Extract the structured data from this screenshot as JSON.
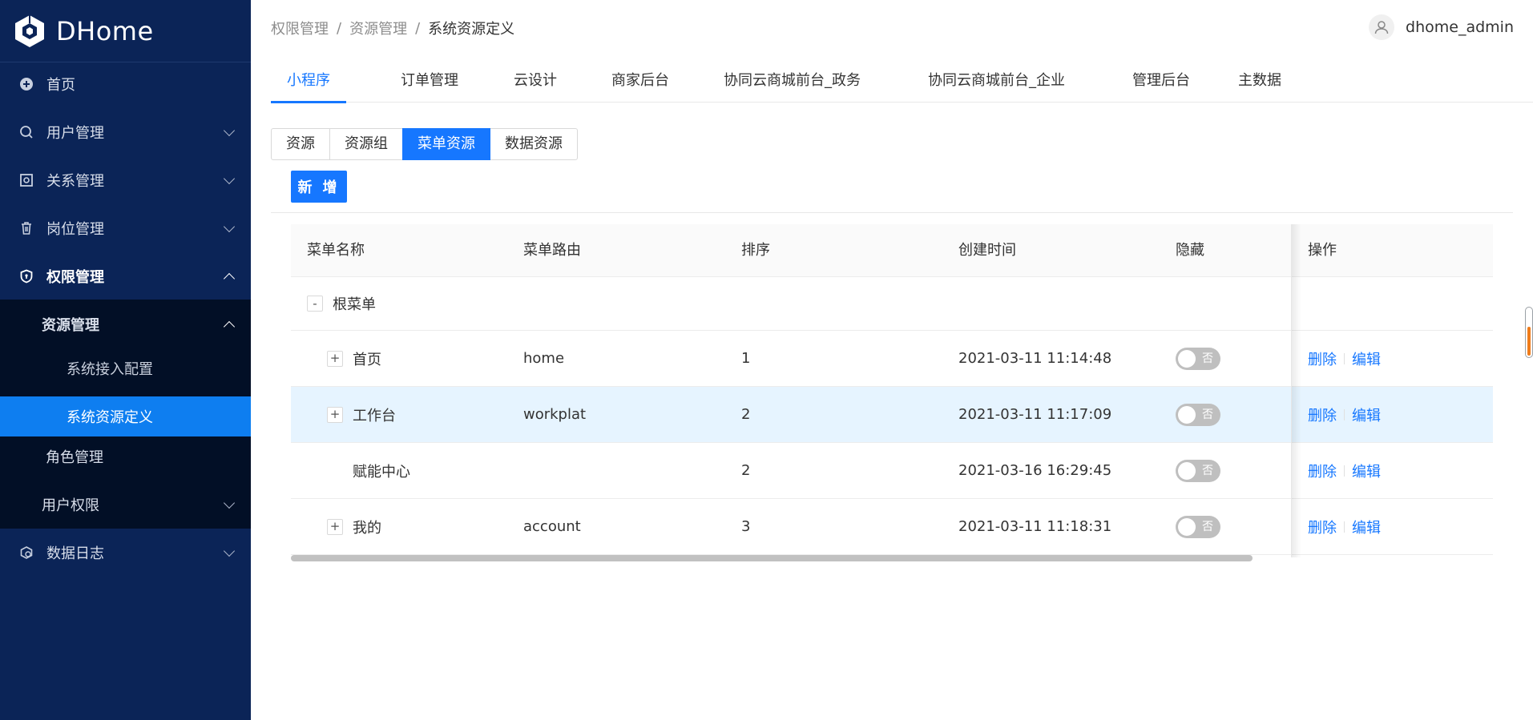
{
  "brand": {
    "name": "DHome"
  },
  "sidebar": {
    "items": [
      {
        "label": "首页",
        "icon": "plus-circle-icon"
      },
      {
        "label": "用户管理",
        "icon": "search-icon"
      },
      {
        "label": "关系管理",
        "icon": "relation-icon"
      },
      {
        "label": "岗位管理",
        "icon": "trash-icon"
      },
      {
        "label": "权限管理",
        "icon": "shield-icon"
      },
      {
        "label": "资源管理"
      },
      {
        "label": "系统接入配置"
      },
      {
        "label": "系统资源定义"
      },
      {
        "label": "角色管理"
      },
      {
        "label": "用户权限"
      },
      {
        "label": "数据日志",
        "icon": "log-icon"
      }
    ]
  },
  "breadcrumb": {
    "items": [
      "权限管理",
      "资源管理",
      "系统资源定义"
    ]
  },
  "user": {
    "name": "dhome_admin"
  },
  "top_tabs": [
    "小程序",
    "订单管理",
    "云设计",
    "商家后台",
    "协同云商城前台_政务",
    "协同云商城前台_企业",
    "管理后台",
    "主数据"
  ],
  "segments": [
    "资源",
    "资源组",
    "菜单资源",
    "数据资源"
  ],
  "add_button": "新 增",
  "table": {
    "columns": [
      "菜单名称",
      "菜单路由",
      "排序",
      "创建时间",
      "隐藏",
      "操作"
    ],
    "root": {
      "expander": "-",
      "name": "根菜单"
    },
    "rows": [
      {
        "expander": "+",
        "name": "首页",
        "route": "home",
        "sort": "1",
        "created": "2021-03-11 11:14:48",
        "hidden": "否",
        "delete": "删除",
        "edit": "编辑"
      },
      {
        "expander": "+",
        "name": "工作台",
        "route": "workplat",
        "sort": "2",
        "created": "2021-03-11 11:17:09",
        "hidden": "否",
        "delete": "删除",
        "edit": "编辑"
      },
      {
        "expander": "",
        "name": "赋能中心",
        "route": "",
        "sort": "2",
        "created": "2021-03-16 16:29:45",
        "hidden": "否",
        "delete": "删除",
        "edit": "编辑"
      },
      {
        "expander": "+",
        "name": "我的",
        "route": "account",
        "sort": "3",
        "created": "2021-03-11 11:18:31",
        "hidden": "否",
        "delete": "删除",
        "edit": "编辑"
      }
    ]
  },
  "colors": {
    "sidebar_bg": "#0b2457",
    "submenu_bg": "#020f26",
    "primary": "#1677ff",
    "highlight_row": "#e6f4ff"
  }
}
